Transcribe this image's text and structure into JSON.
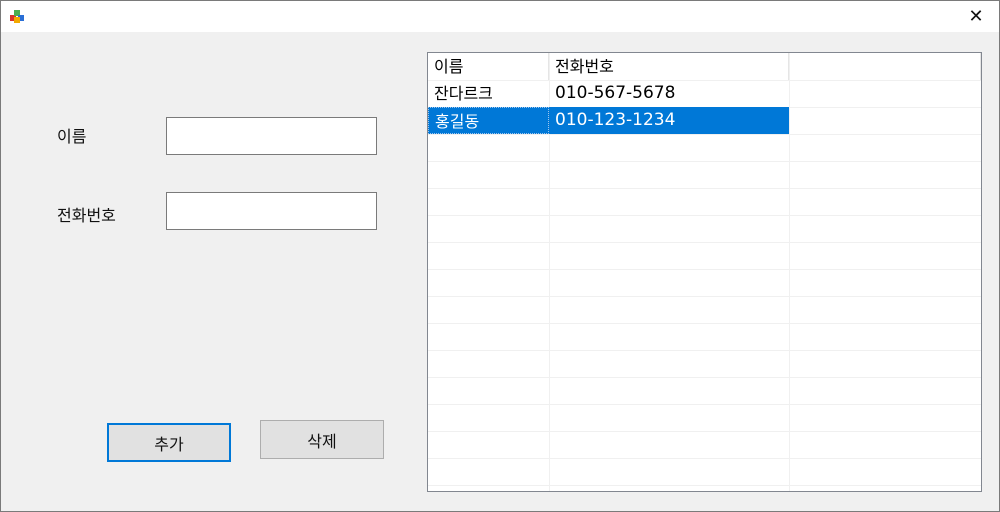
{
  "window": {
    "close_glyph": "✕"
  },
  "form": {
    "name_label": "이름",
    "phone_label": "전화번호",
    "name_value": "",
    "phone_value": ""
  },
  "buttons": {
    "add": "추가",
    "delete": "삭제"
  },
  "list": {
    "columns": [
      "이름",
      "전화번호"
    ],
    "rows": [
      {
        "name": "잔다르크",
        "phone": "010-567-5678",
        "selected": false
      },
      {
        "name": "홍길동",
        "phone": "010-123-1234",
        "selected": true
      }
    ]
  },
  "colors": {
    "selection": "#0078d7",
    "default_button_border": "#0078d7"
  }
}
